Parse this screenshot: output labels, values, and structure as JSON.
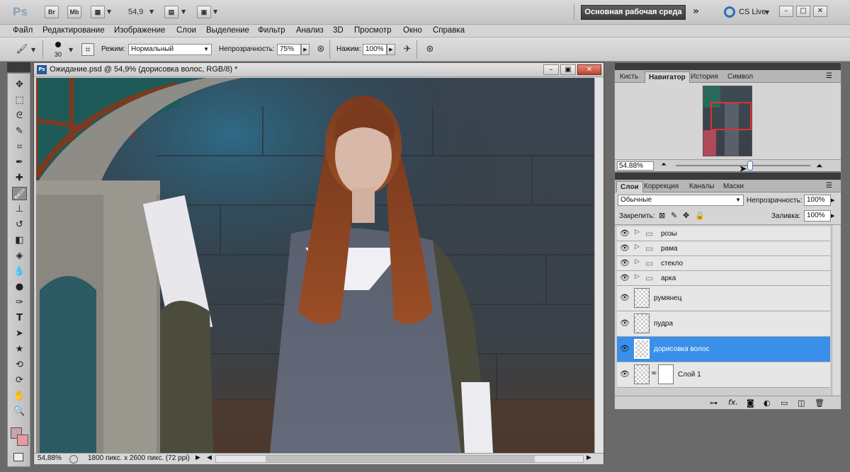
{
  "app": {
    "logo": "Ps",
    "bridge_btn": "Br",
    "minibridge_btn": "Mb",
    "zoom_value": "54,9",
    "workspace_label": "Основная рабочая среда",
    "cs_live": "CS Live"
  },
  "menu": [
    "Файл",
    "Редактирование",
    "Изображение",
    "Слои",
    "Выделение",
    "Фильтр",
    "Анализ",
    "3D",
    "Просмотр",
    "Окно",
    "Справка"
  ],
  "options": {
    "brush_size": "30",
    "mode_label": "Режим:",
    "mode_value": "Нормальный",
    "opacity_label": "Непрозрачность:",
    "opacity_value": "75%",
    "pressure_label": "Нажим:",
    "pressure_value": "100%"
  },
  "document": {
    "title": "Ожидание.psd @ 54,9% (дорисовка волос, RGB/8) *",
    "zoom_status": "54,88%",
    "size_status": "1800 пикс. x 2600 пикс. (72 ppi)"
  },
  "navigator": {
    "tabs": [
      "Кисть",
      "Навигатор",
      "История",
      "Символ"
    ],
    "active_tab": "Навигатор",
    "zoom_value": "54.88%",
    "zoom_slider": 0.55
  },
  "layers_panel": {
    "tabs": [
      "Слои",
      "Коррекция",
      "Каналы",
      "Маски"
    ],
    "active_tab": "Слои",
    "blend_mode": "Обычные",
    "opacity_label": "Непрозрачность:",
    "opacity_value": "100%",
    "lock_label": "Закрепить:",
    "fill_label": "Заливка:",
    "fill_value": "100%",
    "layers": [
      {
        "name": "розы",
        "type": "group"
      },
      {
        "name": "рама",
        "type": "group"
      },
      {
        "name": "стекло",
        "type": "group"
      },
      {
        "name": "арка",
        "type": "group"
      },
      {
        "name": "румянец",
        "type": "layer"
      },
      {
        "name": "пудра",
        "type": "layer"
      },
      {
        "name": "дорисовка волос",
        "type": "layer",
        "selected": true
      },
      {
        "name": "Слой 1",
        "type": "masked"
      }
    ]
  },
  "colors": {
    "accent_selected": "#3a8fe8",
    "foreground": "#c8a4a6",
    "background": "#e59aa5"
  }
}
